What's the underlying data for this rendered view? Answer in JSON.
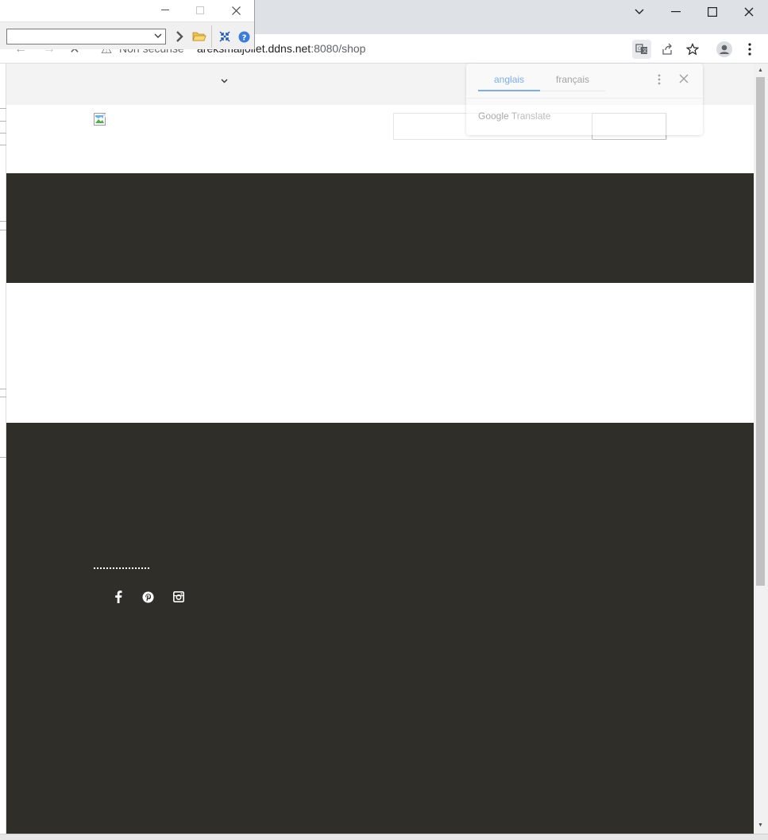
{
  "browser": {
    "url_host": "areksmaljoliet.ddns.net",
    "url_rest": ":8080/shop",
    "security_label": "Non sécurisé"
  },
  "translate_popup": {
    "tab_source": "anglais",
    "tab_target": "français",
    "brand_google": "Google",
    "brand_translate": "Translate"
  },
  "colors": {
    "dark_band": "#2f2e28",
    "topbar": "#f3f3f3",
    "accent_blue": "#1a73e8"
  },
  "icons": {
    "social": [
      "facebook-icon",
      "pinterest-icon",
      "instagram-icon"
    ]
  }
}
